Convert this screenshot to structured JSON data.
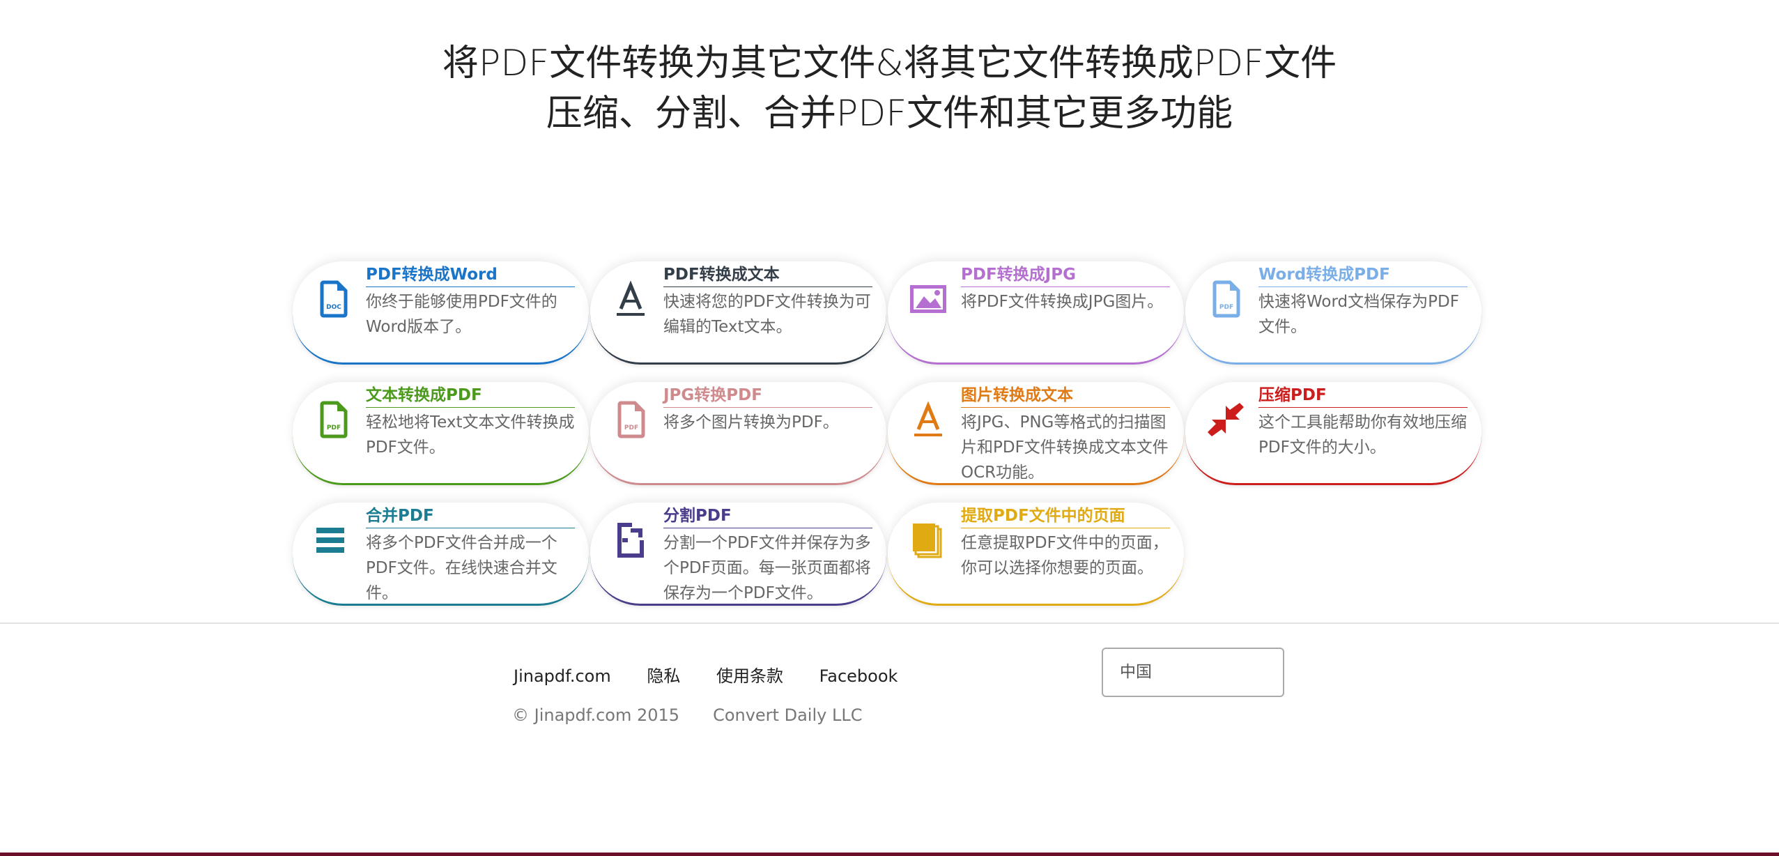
{
  "hero": {
    "line1": "将PDF文件转换为其它文件&将其它文件转换成PDF文件",
    "line2": "压缩、分割、合并PDF文件和其它更多功能"
  },
  "tools": [
    {
      "title": "PDF转换成Word",
      "desc": "你终于能够使用PDF文件的Word版本了。",
      "color": "#1a74c8",
      "icon": "doc-file-icon"
    },
    {
      "title": "PDF转换成文本",
      "desc": "快速将您的PDF文件转换为可编辑的Text文本。",
      "color": "#333e48",
      "icon": "letter-a-icon"
    },
    {
      "title": "PDF转换成JPG",
      "desc": "将PDF文件转换成JPG图片。",
      "color": "#b56fd0",
      "icon": "image-icon"
    },
    {
      "title": "Word转换成PDF",
      "desc": "快速将Word文档保存为PDF文件。",
      "color": "#7aaee6",
      "icon": "pdf-file-icon"
    },
    {
      "title": "文本转换成PDF",
      "desc": "轻松地将Text文本文件转换成PDF文件。",
      "color": "#4b9a1c",
      "icon": "pdf-file-icon"
    },
    {
      "title": "JPG转换PDF",
      "desc": "将多个图片转换为PDF。",
      "color": "#cf8a8e",
      "icon": "pdf-file-icon"
    },
    {
      "title": "图片转换成文本",
      "desc": "将JPG、PNG等格式的扫描图片和PDF文件转换成文本文件OCR功能。",
      "color": "#e07a14",
      "icon": "letter-a-icon"
    },
    {
      "title": "压缩PDF",
      "desc": "这个工具能帮助你有效地压缩PDF文件的大小。",
      "color": "#cc1d1d",
      "icon": "compress-arrows-icon"
    },
    {
      "title": "合并PDF",
      "desc": "将多个PDF文件合并成一个PDF文件。在线快速合并文件。",
      "color": "#1b7c92",
      "icon": "merge-lines-icon"
    },
    {
      "title": "分割PDF",
      "desc": "分割一个PDF文件并保存为多个PDF页面。每一张页面都将保存为一个PDF文件。",
      "color": "#4b3c8c",
      "icon": "split-file-icon"
    },
    {
      "title": "提取PDF文件中的页面",
      "desc": "任意提取PDF文件中的页面，你可以选择你想要的页面。",
      "color": "#e0aa12",
      "icon": "extract-pages-icon"
    }
  ],
  "footer": {
    "links": [
      "Jinapdf.com",
      "隐私",
      "使用条款",
      "Facebook"
    ],
    "copyright": "© Jinapdf.com 2015",
    "company": "Convert Daily LLC",
    "country_placeholder": "中国"
  }
}
